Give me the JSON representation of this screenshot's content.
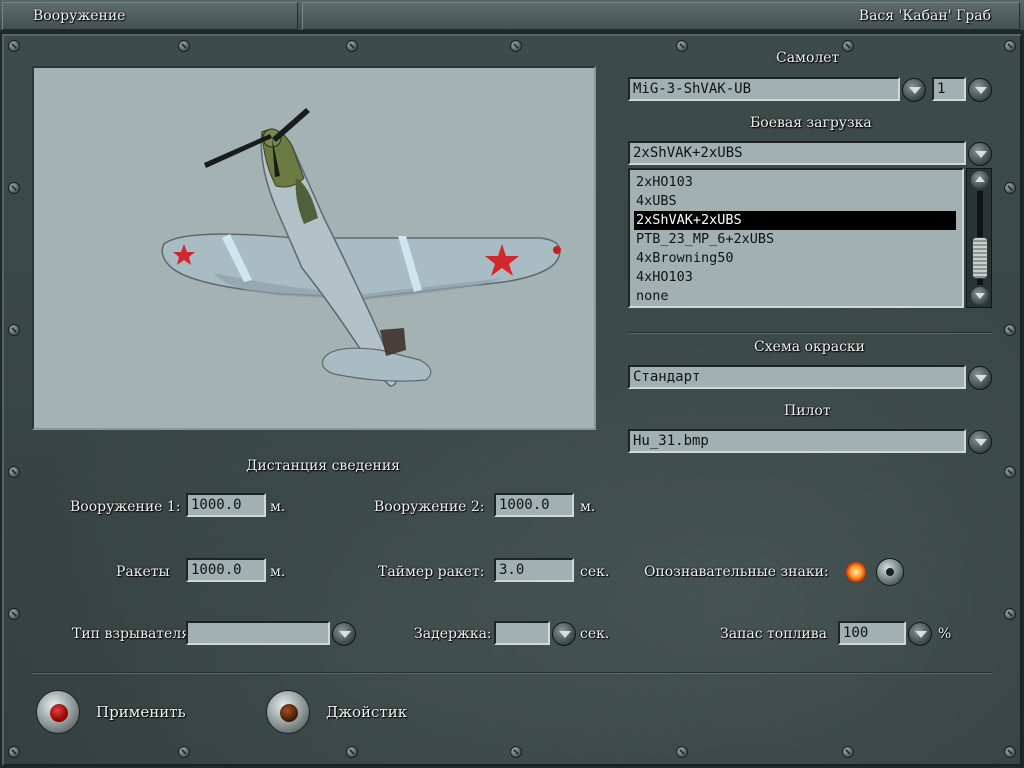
{
  "titlebar": {
    "left_title": "Вооружение",
    "right_title": "Вася 'Кабан' Граб"
  },
  "plane": {
    "section_label": "Самолет",
    "value": "MiG-3-ShVAK-UB",
    "count": "1"
  },
  "loadout": {
    "section_label": "Боевая загрузка",
    "value": "2xShVAK+2xUBS",
    "items": [
      "2xHO103",
      "4xUBS",
      "2xShVAK+2xUBS",
      "PTB_23_MP_6+2xUBS",
      "4xBrowning50",
      "4xHO103",
      "none"
    ],
    "selected_index": 2
  },
  "skin": {
    "section_label": "Схема окраски",
    "value": "Стандарт"
  },
  "pilot": {
    "section_label": "Пилот",
    "value": "Hu_31.bmp"
  },
  "convergence": {
    "heading": "Дистанция сведения",
    "weapons1_label": "Вооружение 1:",
    "weapons1_value": "1000.0",
    "weapons1_unit": "м.",
    "weapons2_label": "Вооружение 2:",
    "weapons2_value": "1000.0",
    "weapons2_unit": "м.",
    "rockets_label": "Ракеты",
    "rockets_value": "1000.0",
    "rockets_unit": "м.",
    "rocket_timer_label": "Таймер ракет:",
    "rocket_timer_value": "3.0",
    "rocket_timer_unit": "сек."
  },
  "insignia_label": "Опознавательные знаки:",
  "fuze": {
    "label": "Тип взрывателя:",
    "value": ""
  },
  "delay": {
    "label": "Задержка:",
    "value": "",
    "unit": "сек."
  },
  "fuel": {
    "label": "Запас топлива",
    "value": "100",
    "unit": "%"
  },
  "buttons": {
    "apply": "Применить",
    "joystick": "Джойстик"
  },
  "colors": {
    "panel": "#3a4848",
    "field": "#a2b0b2",
    "preview_bg": "#a4b2b4",
    "star": "#d0282c"
  },
  "icons": [
    "screw-icon",
    "chevron-down-icon",
    "aircraft-preview"
  ]
}
